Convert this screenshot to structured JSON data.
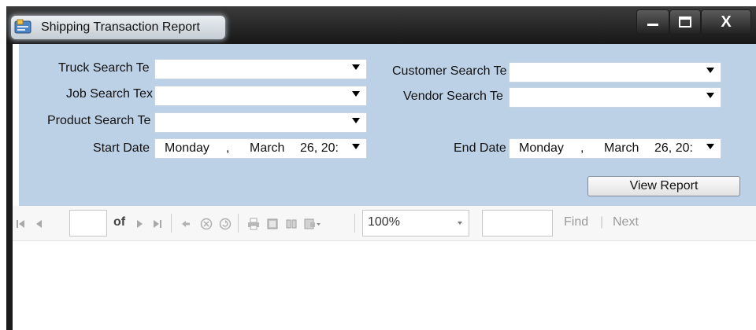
{
  "window": {
    "title": "Shipping Transaction Report",
    "close_label": "X"
  },
  "params": {
    "truck_label": "Truck Search Te",
    "job_label": "Job Search Tex",
    "product_label": "Product Search Te",
    "start_label": "Start Date",
    "customer_label": "Customer Search Te",
    "vendor_label": "Vendor Search Te",
    "end_label": "End Date",
    "start_date": {
      "weekday": "Monday",
      "sep": ",",
      "month": "March",
      "day": "26, 20:"
    },
    "end_date": {
      "weekday": "Monday",
      "sep": ",",
      "month": "March",
      "day": "26, 20:"
    },
    "view_report": "View Report"
  },
  "toolbar": {
    "of": "of",
    "zoom": "100%",
    "find": "Find",
    "divider": "|",
    "next": "Next"
  }
}
